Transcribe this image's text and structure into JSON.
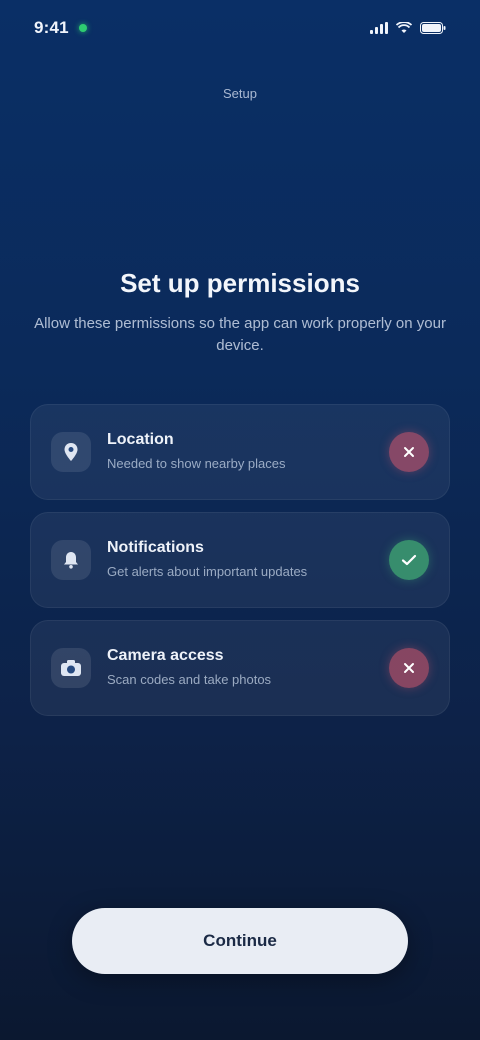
{
  "status_bar": {
    "time": "9:41",
    "icons": [
      "signal-icon",
      "wifi-icon",
      "battery-icon"
    ]
  },
  "top": {
    "subtitle": "Setup"
  },
  "heading": {
    "title": "Set up permissions",
    "description": "Allow these permissions so the app can work properly on your device."
  },
  "permissions": [
    {
      "title": "Location",
      "description": "Needed to show nearby places",
      "icon": "location-icon",
      "status": "denied"
    },
    {
      "title": "Notifications",
      "description": "Get alerts about important updates",
      "icon": "bell-icon",
      "status": "granted"
    },
    {
      "title": "Camera access",
      "description": "Scan codes and take photos",
      "icon": "camera-icon",
      "status": "denied"
    }
  ],
  "cta": {
    "label": "Continue"
  },
  "colors": {
    "background_top": "#0a2f66",
    "background_bottom": "#0b1830",
    "granted": "#46be78",
    "denied": "#e05a6e",
    "button_bg": "#e9edf4"
  }
}
